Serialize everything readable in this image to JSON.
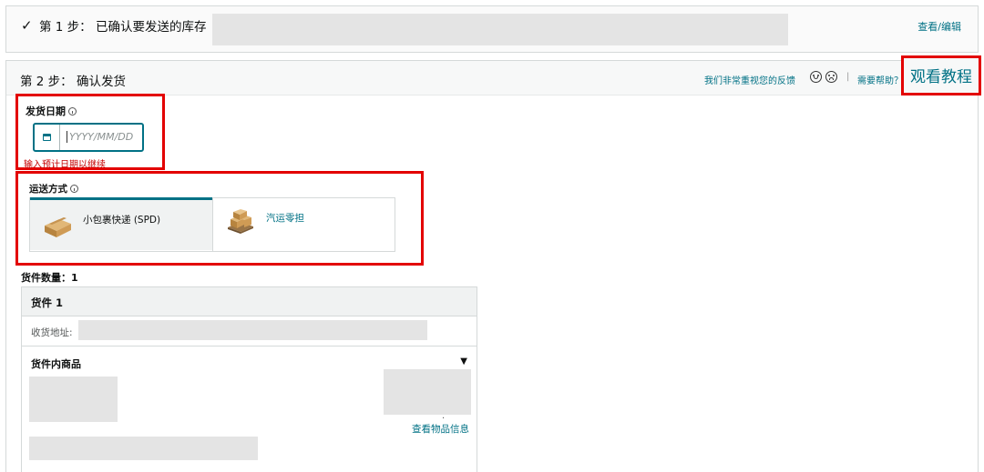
{
  "step1": {
    "check_icon": "checkmark-icon",
    "title": "第 1 步：  已确认要发送的库存",
    "edit_link": "查看/编辑"
  },
  "step2": {
    "title": "第 2 步：  确认发货",
    "feedback_text": "我们非常重视您的反馈",
    "feedback_icons": [
      "happy-face-icon",
      "sad-face-icon"
    ],
    "separator": "|",
    "help_text": "需要帮助？",
    "tutorial_link": "观看教程"
  },
  "ship_date": {
    "label": "发货日期",
    "placeholder": "YYYY/MM/DD",
    "error": "输入预计日期以继续"
  },
  "shipping_method": {
    "label": "运送方式",
    "options": [
      {
        "label": "小包裹快递 (SPD)",
        "selected": true
      },
      {
        "label": "汽运零担",
        "selected": false
      }
    ]
  },
  "shipments": {
    "count_label": "货件数量：1",
    "shipment": {
      "title": "货件 1",
      "address_label": "收货地址:",
      "items_label": "货件内商品",
      "toggle": "▼",
      "dot": ".",
      "view_items_link": "查看物品信息"
    }
  },
  "colors": {
    "link": "#007185",
    "highlight": "#e30000",
    "error": "#c40000"
  }
}
